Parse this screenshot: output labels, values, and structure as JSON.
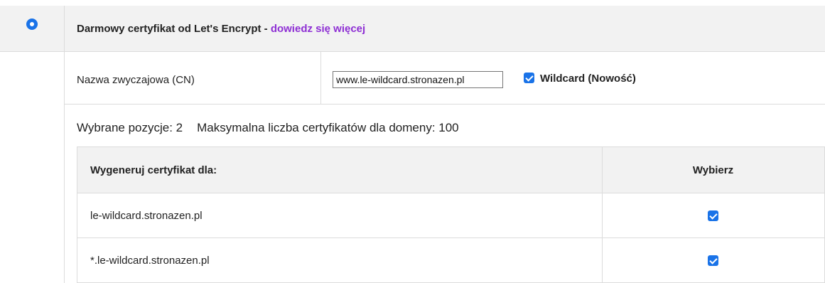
{
  "header": {
    "title": "Darmowy certyfikat od Let's Encrypt - ",
    "link": "dowiedz się więcej",
    "selected": true
  },
  "cn": {
    "label": "Nazwa zwyczajowa (CN)",
    "value": "www.le-wildcard.stronazen.pl",
    "wildcard_label": "Wildcard (Nowość)",
    "wildcard_checked": true
  },
  "summary": {
    "selected_text": "Wybrane pozycje: 2",
    "max_text": "Maksymalna liczba certyfikatów dla domeny: 100"
  },
  "table": {
    "headers": [
      "Wygeneruj certyfikat dla:",
      "Wybierz"
    ],
    "rows": [
      {
        "domain": "le-wildcard.stronazen.pl",
        "checked": true
      },
      {
        "domain": "*.le-wildcard.stronazen.pl",
        "checked": true
      }
    ]
  },
  "colors": {
    "accent": "#1a73e8",
    "link": "#8e2fd4",
    "header_bg": "#f2f2f2",
    "border": "#dcdcdc"
  }
}
